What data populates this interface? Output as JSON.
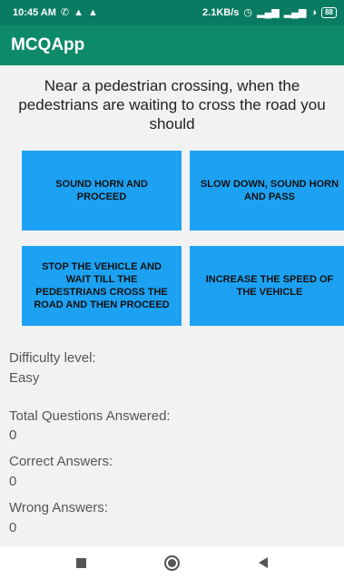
{
  "status_bar": {
    "time": "10:45 AM",
    "left_icons": [
      "whatsapp-icon",
      "notification-icon",
      "notification-icon"
    ],
    "net_speed": "2.1KB/s",
    "battery": "88"
  },
  "app": {
    "title": "MCQApp"
  },
  "question": "Near a pedestrian crossing, when the pedestrians are waiting to cross the road you should",
  "options": [
    "SOUND HORN AND PROCEED",
    "SLOW DOWN, SOUND HORN AND PASS",
    "STOP THE VEHICLE AND WAIT TILL THE PEDESTRIANS CROSS THE ROAD AND THEN PROCEED",
    "INCREASE THE SPEED OF THE VEHICLE"
  ],
  "colors": {
    "status_bar": "#0a7b63",
    "app_bar": "#0d8a6a",
    "option_button": "#1da1f2",
    "content_bg": "#f2f2f2"
  },
  "stats": {
    "difficulty_label": "Difficulty level:",
    "difficulty_value": "Easy",
    "total_label": "Total Questions Answered:",
    "total_value": "0",
    "correct_label": "Correct Answers:",
    "correct_value": "0",
    "wrong_label": "Wrong Answers:",
    "wrong_value": "0"
  },
  "nav": [
    "recents-square-icon",
    "home-circle-icon",
    "back-triangle-icon"
  ]
}
